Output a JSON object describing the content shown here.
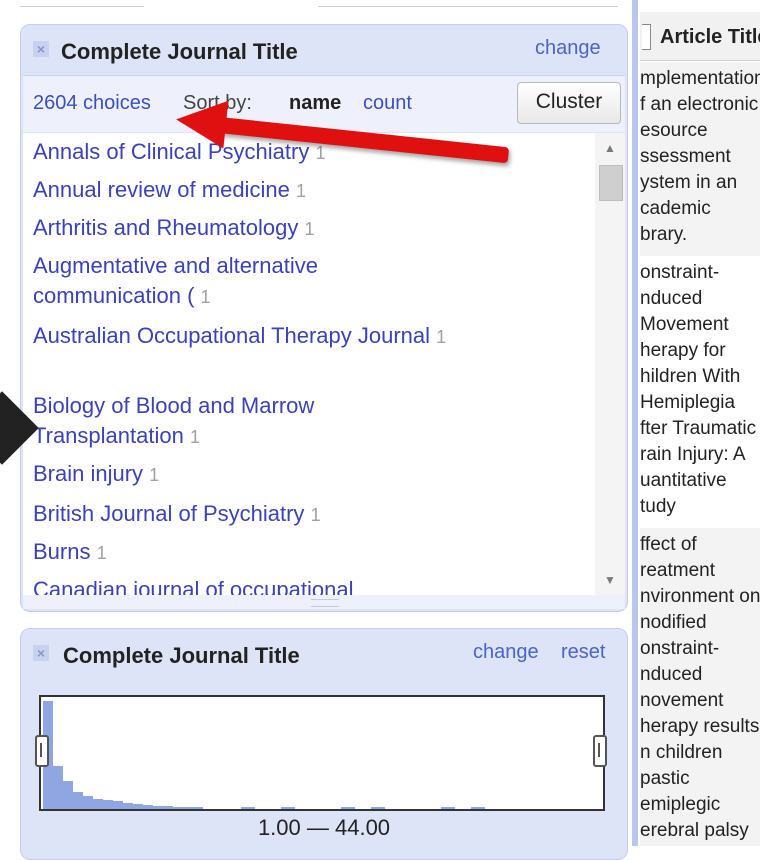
{
  "facet_text": {
    "title": "Complete Journal Title",
    "change_label": "change",
    "choices_label": "2604 choices",
    "sort_by_label": "Sort by:",
    "sort_name_label": "name",
    "sort_count_label": "count",
    "cluster_label": "Cluster",
    "items": [
      {
        "name": "Annals of Clinical Psychiatry",
        "count": "1"
      },
      {
        "name": "Annual review of medicine",
        "count": "1"
      },
      {
        "name": "Arthritis and Rheumatology",
        "count": "1"
      },
      {
        "name": "Augmentative and alternative communication (",
        "count": "1"
      },
      {
        "name": "Australian Occupational Therapy Journal",
        "count": "1"
      },
      {
        "name": "Biology of Blood and Marrow Transplantation",
        "count": "1"
      },
      {
        "name": "Brain injury",
        "count": "1"
      },
      {
        "name": "British Journal of Psychiatry",
        "count": "1"
      },
      {
        "name": "Burns",
        "count": "1"
      },
      {
        "name": "Canadian journal of occupational",
        "count": ""
      }
    ]
  },
  "facet_numeric": {
    "title": "Complete Journal Title",
    "change_label": "change",
    "reset_label": "reset",
    "range_label": "1.00 — 44.00",
    "histogram_relative_heights": [
      1.0,
      0.4,
      0.26,
      0.16,
      0.12,
      0.09,
      0.08,
      0.07,
      0.06,
      0.05,
      0.04,
      0.03,
      0.03,
      0.02,
      0.02,
      0.015
    ]
  },
  "right_column": {
    "header": "Article Title",
    "rows": [
      {
        "text": "mplementation\nf an electronic\nesource\nssessment\nystem in an\ncademic\nbrary.",
        "shaded": true
      },
      {
        "text": "onstraint-\nnduced\nMovement\nherapy for\nhildren With\nHemiplegia\nfter Traumatic\nrain Injury: A\nuantitative\ntudy",
        "shaded": false
      },
      {
        "text": "ffect of\nreatment\nnvironment on\nnodified\nonstraint-\nnduced\nnovement\nherapy results\nn children\npastic\nemiplegic\nerebral palsy",
        "shaded": true
      }
    ]
  },
  "colors": {
    "facet_bg": "#dde4f8",
    "link": "#3a42b6",
    "histogram": "#8fa6e2",
    "arrow": "#e01010"
  }
}
